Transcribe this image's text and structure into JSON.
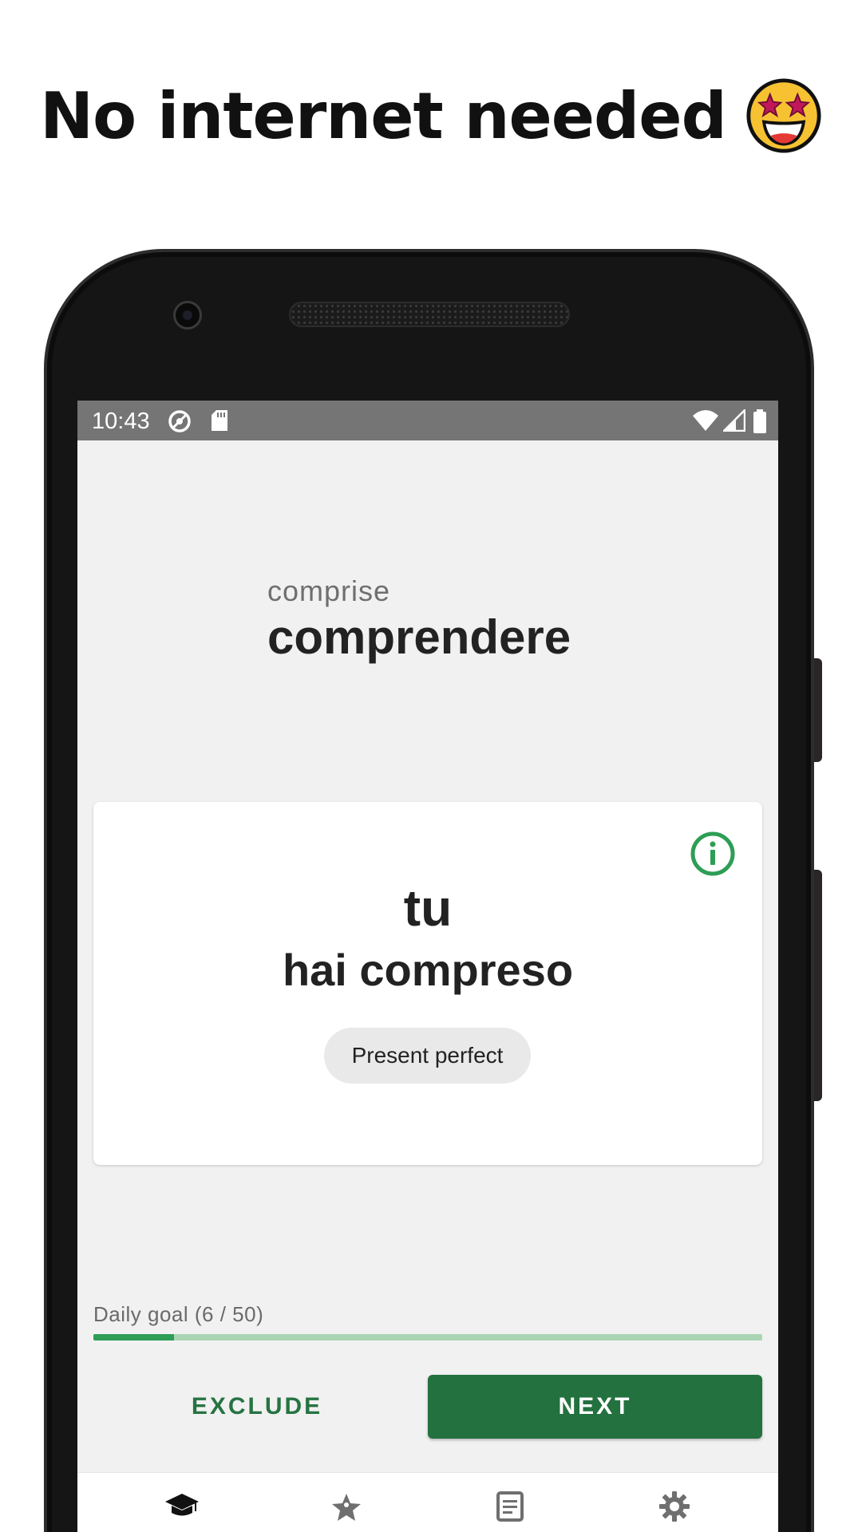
{
  "headline": {
    "text": "No internet needed",
    "emoji": "star-struck-emoji"
  },
  "status_bar": {
    "time": "10:43",
    "icons": [
      "do-not-disturb-icon",
      "sd-card-icon",
      "wifi-icon",
      "cell-signal-icon",
      "battery-icon"
    ]
  },
  "prompt": {
    "translation": "comprise",
    "infinitive": "comprendere"
  },
  "card": {
    "pronoun": "tu",
    "conjugation": "hai compreso",
    "tense": "Present perfect",
    "info_icon": "info-icon"
  },
  "daily_goal": {
    "label": "Daily goal (6 / 50)",
    "current": 6,
    "target": 50,
    "progress_fraction": 0.12
  },
  "actions": {
    "exclude_label": "EXCLUDE",
    "next_label": "NEXT"
  },
  "bottom_nav": {
    "items": [
      {
        "icon": "graduation-cap-icon",
        "active": true
      },
      {
        "icon": "star-person-icon",
        "active": false
      },
      {
        "icon": "document-icon",
        "active": false
      },
      {
        "icon": "gear-icon",
        "active": false
      }
    ]
  },
  "colors": {
    "accent_green": "#23713f",
    "progress_green": "#2e9d55",
    "progress_track": "#a9d5b4",
    "status_bar": "#757575",
    "screen_background": "#f1f1f1"
  }
}
